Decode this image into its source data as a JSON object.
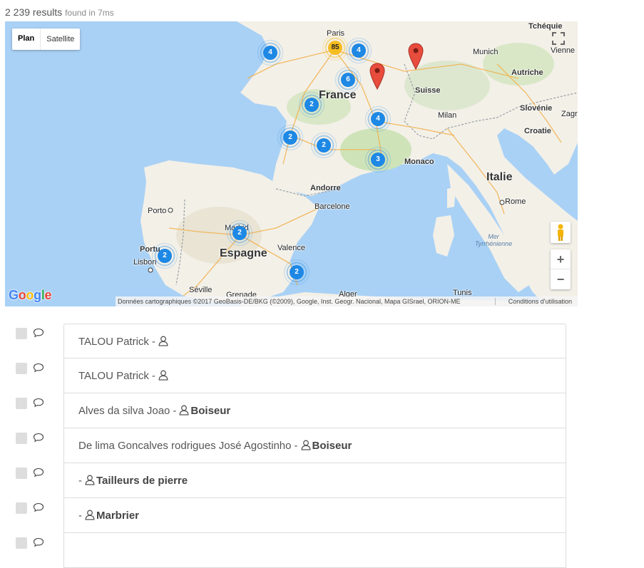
{
  "header": {
    "count": "2 239 results",
    "found": "found in 7ms"
  },
  "map": {
    "type_control": {
      "plan": "Plan",
      "satellite": "Satellite"
    },
    "zoom": {
      "in": "+",
      "out": "−"
    },
    "logo": {
      "G": "G",
      "o1": "o",
      "o2": "o",
      "g": "g",
      "l": "l",
      "e": "e"
    },
    "attribution": "Données cartographiques ©2017 GeoBasis-DE/BKG (©2009), Google, Inst. Geogr. Nacional, Mapa GISrael, ORION-ME",
    "terms": "Conditions d'utilisation",
    "labels": {
      "paris": "Paris",
      "france": "France",
      "munich": "Munich",
      "tcheque": "Tchéquie",
      "vienne": "Vienne",
      "autriche": "Autriche",
      "suisse": "Suisse",
      "milan": "Milan",
      "slovenie": "Slovénie",
      "zagreb": "Zagr",
      "croatie": "Croatie",
      "monaco": "Monaco",
      "italie": "Italie",
      "rome": "Rome",
      "andorre": "Andorre",
      "barcelone": "Barcelone",
      "porto": "Porto",
      "portugal": "Portu",
      "lisbonne": "Lisbon",
      "madrid": "Madrid",
      "espagne": "Espagne",
      "valence": "Valence",
      "seville": "Séville",
      "grenade": "Grenade",
      "alger": "Alger",
      "tunis": "Tunis",
      "mer": "Mer",
      "tyrrhenienne": "Tyrrhénienne"
    },
    "clusters": [
      {
        "count": "4"
      },
      {
        "count": "85"
      },
      {
        "count": "4"
      },
      {
        "count": "6"
      },
      {
        "count": "2"
      },
      {
        "count": "4"
      },
      {
        "count": "2"
      },
      {
        "count": "2"
      },
      {
        "count": "3"
      },
      {
        "count": "2"
      },
      {
        "count": "2"
      },
      {
        "count": "2"
      }
    ],
    "accent_blue": "#1e88e5",
    "accent_yellow": "#f5bd1f",
    "marker_red": "#e74c3c"
  },
  "results": [
    {
      "name": "TALOU Patrick",
      "sep": "-",
      "role": ""
    },
    {
      "name": "TALOU Patrick",
      "sep": "-",
      "role": ""
    },
    {
      "name": "Alves da silva Joao",
      "sep": "-",
      "role": "Boiseur"
    },
    {
      "name": "De lima Goncalves rodrigues José Agostinho",
      "sep": "-",
      "role": "Boiseur"
    },
    {
      "name": "",
      "sep": "-",
      "role": "Tailleurs de pierre"
    },
    {
      "name": "",
      "sep": "-",
      "role": "Marbrier"
    },
    {
      "name": "",
      "sep": "",
      "role": ""
    }
  ]
}
